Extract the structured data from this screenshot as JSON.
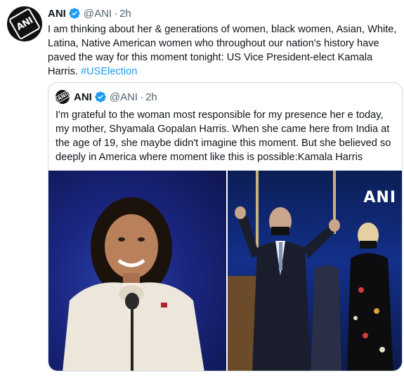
{
  "tweet": {
    "author_name": "ANI",
    "handle": "@ANI",
    "separator": "·",
    "time": "2h",
    "body": "I am thinking about her & generations of women, black women, Asian, White, Latina, Native American women who throughout our nation's history have paved the way for this moment tonight: US Vice President-elect Kamala Harris. ",
    "hashtag": "#USElection"
  },
  "quoted_tweet": {
    "author_name": "ANI",
    "handle": "@ANI",
    "separator": "·",
    "time": "2h",
    "body": "I'm grateful to the woman most responsible for my presence her e today, my mother, Shyamala Gopalan Harris. When she came here from India at the age of 19, she maybe didn't imagine this moment. But she believed so deeply in America where moment like this is possible:Kamala Harris"
  },
  "media": {
    "watermark": "ANI"
  },
  "logo": {
    "text": "ANI"
  },
  "colors": {
    "accent": "#1d9bf0",
    "secondary_text": "#536471",
    "border": "#cfd9de"
  },
  "icons": {
    "verified": "verified-badge-icon"
  }
}
